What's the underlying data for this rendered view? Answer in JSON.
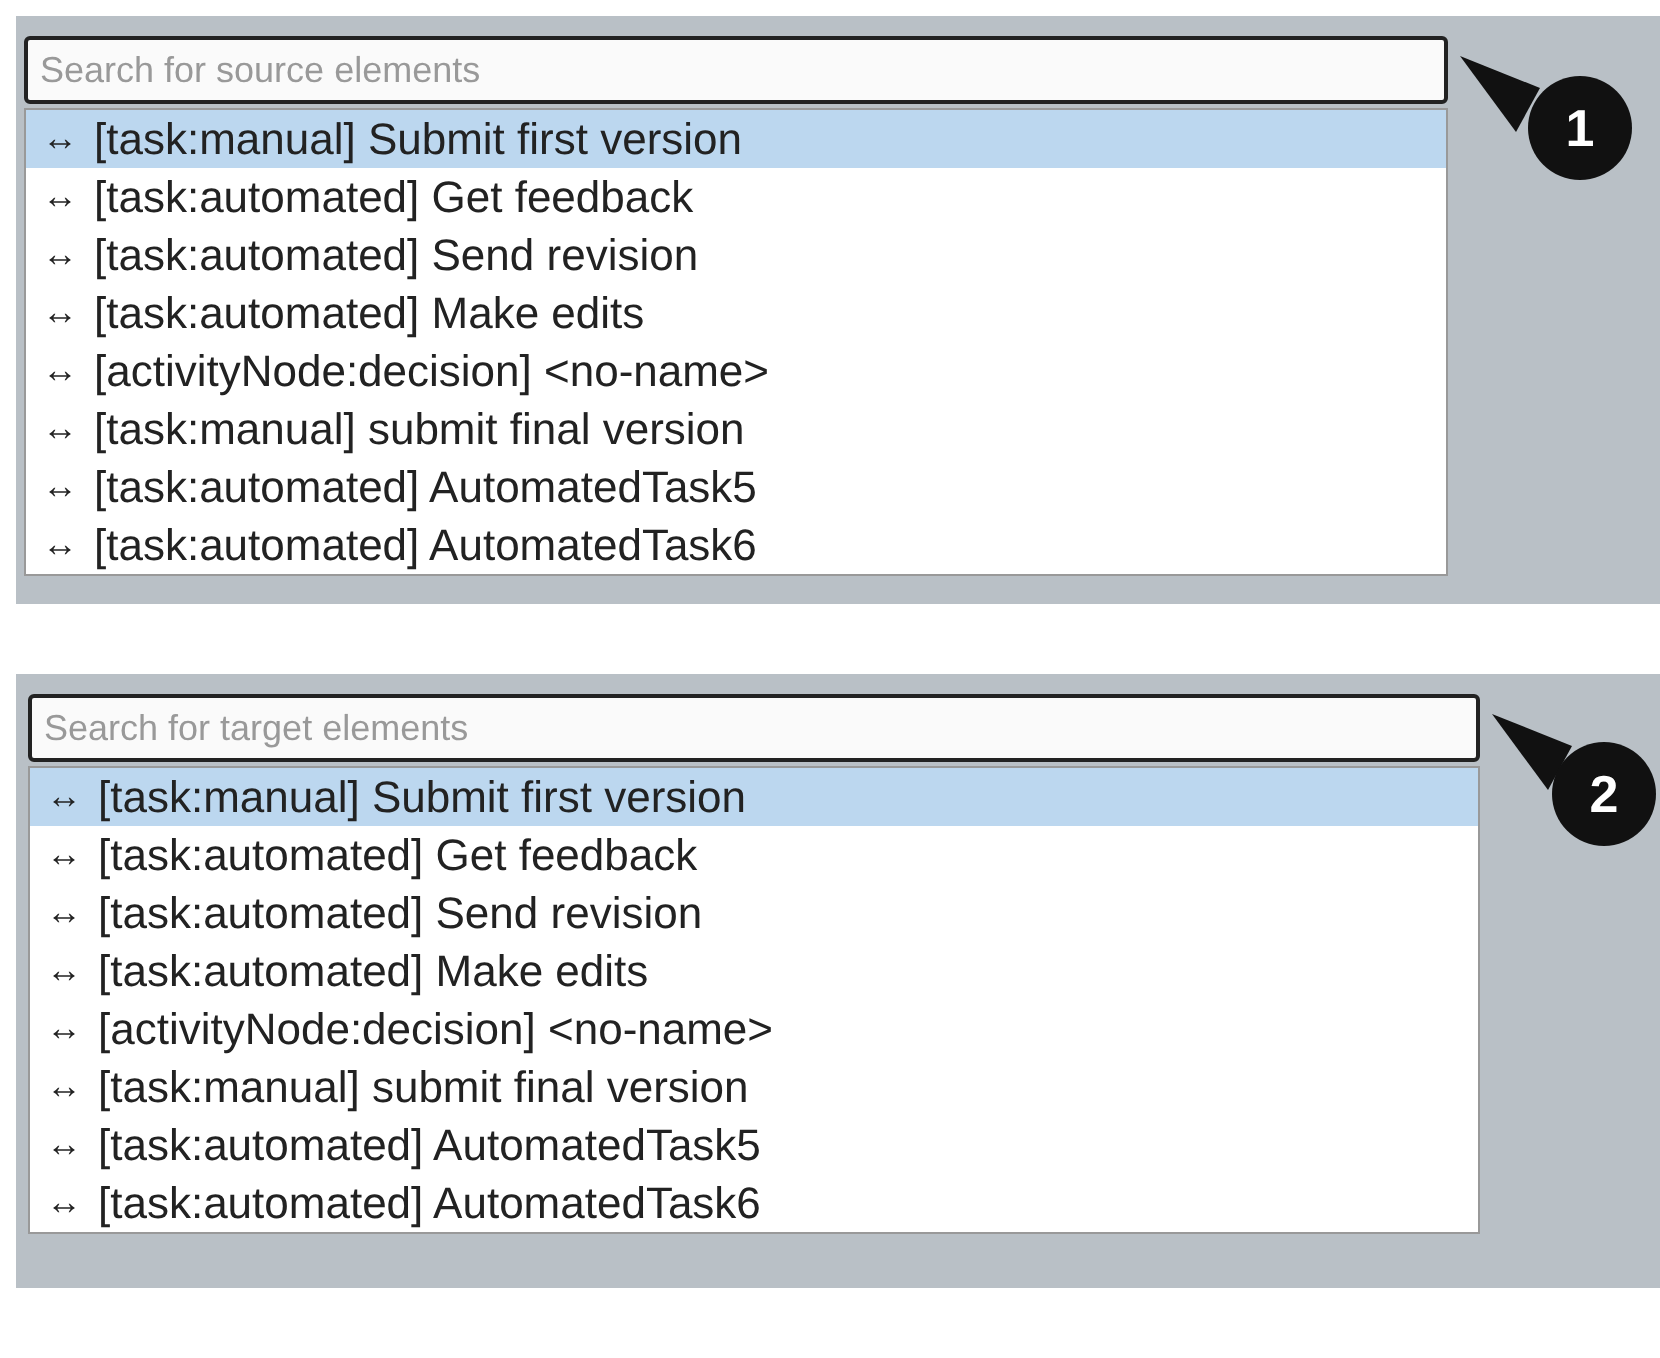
{
  "panels": [
    {
      "search": {
        "placeholder": "Search for source elements"
      },
      "callout": "1",
      "items": [
        {
          "symbol": "↔",
          "label": "[task:manual] Submit first version",
          "selected": true
        },
        {
          "symbol": "↔",
          "label": "[task:automated] Get feedback",
          "selected": false
        },
        {
          "symbol": "↔",
          "label": "[task:automated] Send revision",
          "selected": false
        },
        {
          "symbol": "↔",
          "label": "[task:automated] Make edits",
          "selected": false
        },
        {
          "symbol": "↔",
          "label": "[activityNode:decision] <no-name>",
          "selected": false
        },
        {
          "symbol": "↔",
          "label": "[task:manual] submit final version",
          "selected": false
        },
        {
          "symbol": "↔",
          "label": "[task:automated] AutomatedTask5",
          "selected": false
        },
        {
          "symbol": "↔",
          "label": "[task:automated] AutomatedTask6",
          "selected": false
        }
      ]
    },
    {
      "search": {
        "placeholder": "Search for target elements"
      },
      "callout": "2",
      "items": [
        {
          "symbol": "↔",
          "label": "[task:manual] Submit first version",
          "selected": true
        },
        {
          "symbol": "↔",
          "label": "[task:automated] Get feedback",
          "selected": false
        },
        {
          "symbol": "↔",
          "label": "[task:automated] Send revision",
          "selected": false
        },
        {
          "symbol": "↔",
          "label": "[task:automated] Make edits",
          "selected": false
        },
        {
          "symbol": "↔",
          "label": "[activityNode:decision] <no-name>",
          "selected": false
        },
        {
          "symbol": "↔",
          "label": "[task:manual] submit final version",
          "selected": false
        },
        {
          "symbol": "↔",
          "label": "[task:automated] AutomatedTask5",
          "selected": false
        },
        {
          "symbol": "↔",
          "label": "[task:automated] AutomatedTask6",
          "selected": false
        }
      ]
    }
  ]
}
